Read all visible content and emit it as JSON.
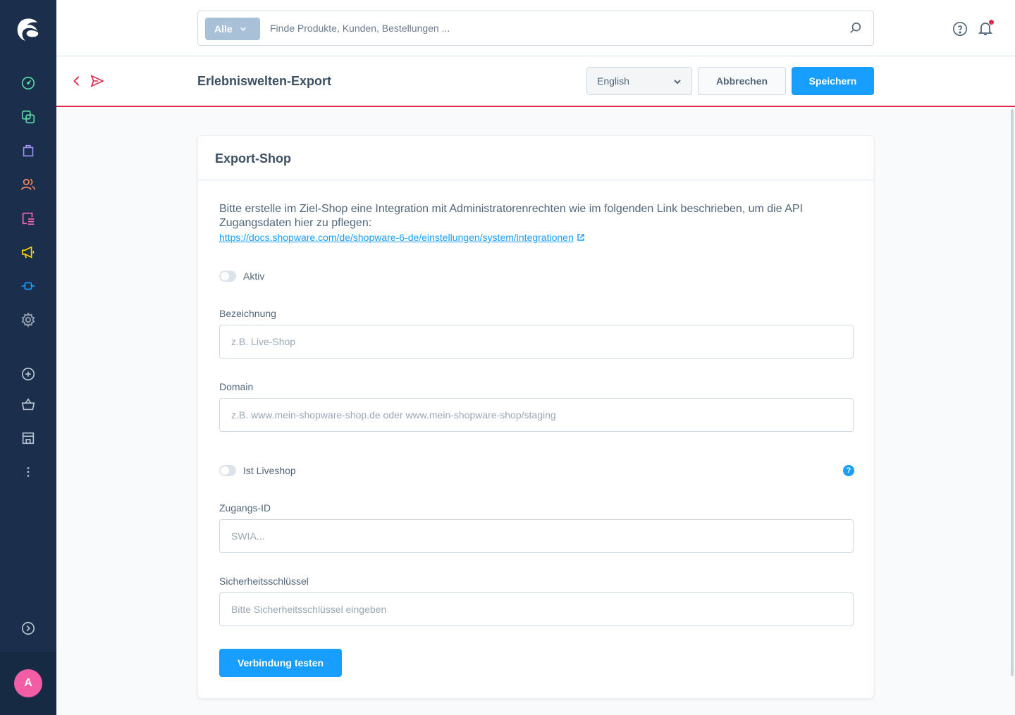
{
  "colors": {
    "sidebar_bg": "#1b2e4b",
    "accent": "#189eff",
    "smartbar_border": "#de294c",
    "avatar": "#f25da5"
  },
  "sidebar": {
    "items": [
      {
        "name": "dashboard-icon",
        "color": "#57d9a3"
      },
      {
        "name": "catalog-icon",
        "color": "#57d9a3"
      },
      {
        "name": "orders-icon",
        "color": "#a092f0"
      },
      {
        "name": "customers-icon",
        "color": "#f88962"
      },
      {
        "name": "content-icon",
        "color": "#ff68b4"
      },
      {
        "name": "marketing-icon",
        "color": "#ffd700"
      },
      {
        "name": "extensions-icon",
        "color": "#189eff"
      },
      {
        "name": "settings-icon",
        "color": "#9aa8b5"
      }
    ],
    "secondary": [
      "add-circle-icon",
      "basket-icon",
      "storefront-icon",
      "more-icon"
    ],
    "collapse_icon": "chevron-circle-icon",
    "avatar_initial": "A"
  },
  "search": {
    "type_label": "Alle",
    "placeholder": "Finde Produkte, Kunden, Bestellungen ..."
  },
  "smartbar": {
    "title": "Erlebniswelten-Export",
    "language": "English",
    "cancel_label": "Abbrechen",
    "save_label": "Speichern"
  },
  "card": {
    "title": "Export-Shop",
    "intro": "Bitte erstelle im Ziel-Shop eine Integration mit Administratorenrechten wie im folgenden Link beschrieben, um die API Zugangsdaten hier zu pflegen:",
    "link": "https://docs.shopware.com/de/shopware-6-de/einstellungen/system/integrationen",
    "active_label": "Aktiv",
    "name_label": "Bezeichnung",
    "name_placeholder": "z.B. Live-Shop",
    "domain_label": "Domain",
    "domain_placeholder": "z.B. www.mein-shopware-shop.de oder www.mein-shopware-shop/staging",
    "liveshop_label": "Ist Liveshop",
    "access_label": "Zugangs-ID",
    "access_placeholder": "SWIA...",
    "secret_label": "Sicherheitsschlüssel",
    "secret_placeholder": "Bitte Sicherheitsschlüssel eingeben",
    "test_label": "Verbindung testen"
  }
}
